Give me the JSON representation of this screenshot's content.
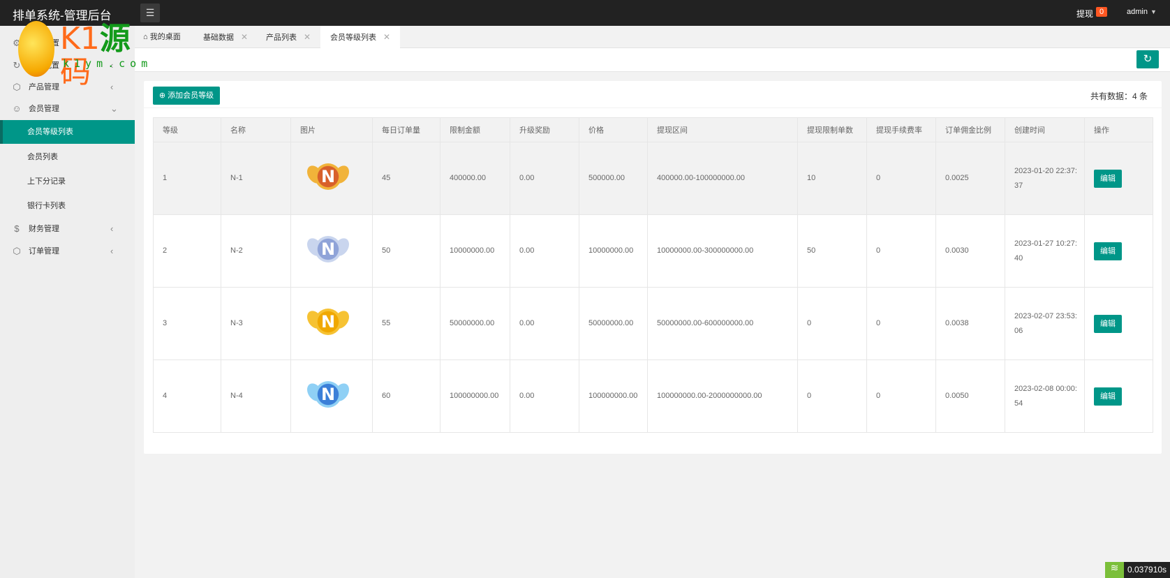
{
  "header": {
    "title": "排单系统-管理后台",
    "withdraw_label": "提现",
    "withdraw_count": "0",
    "user": "admin"
  },
  "sidebar": {
    "items": [
      {
        "label": "系统设置",
        "icon": "gear-icon"
      },
      {
        "label": "基础配置",
        "icon": "refresh-icon"
      },
      {
        "label": "产品管理",
        "icon": "cube-icon"
      },
      {
        "label": "会员管理",
        "icon": "user-icon"
      },
      {
        "label": "会员等级列表"
      },
      {
        "label": "会员列表"
      },
      {
        "label": "上下分记录"
      },
      {
        "label": "银行卡列表"
      },
      {
        "label": "财务管理",
        "icon": "dollar-icon"
      },
      {
        "label": "订单管理",
        "icon": "cube-icon"
      }
    ]
  },
  "tabs": [
    {
      "label": "我的桌面"
    },
    {
      "label": "基础数据"
    },
    {
      "label": "产品列表"
    },
    {
      "label": "会员等级列表"
    }
  ],
  "toolbar": {
    "add_label": "添加会员等级",
    "count_text": "共有数据：4 条"
  },
  "table": {
    "headers": [
      "等级",
      "名称",
      "图片",
      "每日订单量",
      "限制金额",
      "升级奖励",
      "价格",
      "提现区间",
      "提现限制单数",
      "提现手续费率",
      "订单佣金比例",
      "创建时间",
      "操作"
    ],
    "rows": [
      {
        "level": "1",
        "name": "N-1",
        "medal": "bronze",
        "daily": "45",
        "limit": "400000.00",
        "bonus": "0.00",
        "price": "500000.00",
        "range": "400000.00-100000000.00",
        "wd_limit": "10",
        "fee": "0",
        "commission": "0.0025",
        "created": "2023-01-20 22:37:37",
        "action": "编辑"
      },
      {
        "level": "2",
        "name": "N-2",
        "medal": "silver",
        "daily": "50",
        "limit": "10000000.00",
        "bonus": "0.00",
        "price": "10000000.00",
        "range": "10000000.00-300000000.00",
        "wd_limit": "50",
        "fee": "0",
        "commission": "0.0030",
        "created": "2023-01-27 10:27:40",
        "action": "编辑"
      },
      {
        "level": "3",
        "name": "N-3",
        "medal": "gold",
        "daily": "55",
        "limit": "50000000.00",
        "bonus": "0.00",
        "price": "50000000.00",
        "range": "50000000.00-600000000.00",
        "wd_limit": "0",
        "fee": "0",
        "commission": "0.0038",
        "created": "2023-02-07 23:53:06",
        "action": "编辑"
      },
      {
        "level": "4",
        "name": "N-4",
        "medal": "diamond",
        "daily": "60",
        "limit": "100000000.00",
        "bonus": "0.00",
        "price": "100000000.00",
        "range": "100000000.00-2000000000.00",
        "wd_limit": "0",
        "fee": "0",
        "commission": "0.0050",
        "created": "2023-02-08 00:00:54",
        "action": "编辑"
      }
    ]
  },
  "watermark": {
    "brand": "K1源码",
    "url": "k1ym.com"
  },
  "debug": {
    "time": "0.037910s"
  },
  "colors": {
    "accent": "#009688",
    "badge": "#ff5722",
    "topbar": "#222222"
  }
}
